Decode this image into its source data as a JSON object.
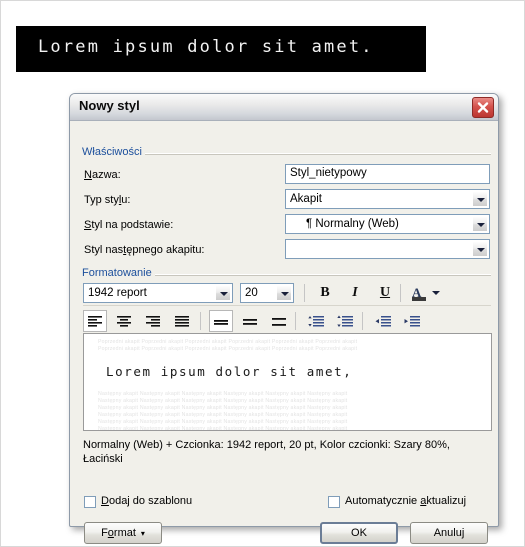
{
  "banner": {
    "text": "Lorem ipsum dolor sit amet."
  },
  "dialog": {
    "title": "Nowy styl",
    "close_icon": "close-icon",
    "properties": {
      "group_label": "Właściwości",
      "name_label": "Nazwa:",
      "name_value": "Styl_nietypowy",
      "style_type_label": "Typ stylu:",
      "style_type_value": "Akapit",
      "based_on_label": "Styl na podstawie:",
      "based_on_value": "¶ Normalny (Web)",
      "next_style_label": "Styl następnego akapitu:",
      "next_style_value": ""
    },
    "formatting": {
      "group_label": "Formatowanie",
      "font_family": "1942 report",
      "font_size": "20",
      "bold": "B",
      "italic": "I",
      "underline": "U",
      "font_color": "A",
      "align_left": "align-left-icon",
      "align_center": "align-center-icon",
      "align_right": "align-right-icon",
      "align_justify": "align-justify-icon",
      "line_single": "line-spacing-single-icon",
      "line_1_5": "line-spacing-1-5-icon",
      "line_double": "line-spacing-double-icon",
      "space_before": "space-before-icon",
      "space_after": "space-after-icon",
      "indent_decrease": "decrease-indent-icon",
      "indent_increase": "increase-indent-icon"
    },
    "preview": {
      "placeholder_text": "Poprzedni akapit Poprzedni akapit Poprzedni akapit Poprzedni akapit Poprzedni akapit Poprzedni akapit",
      "sample_text": "Lorem ipsum dolor sit amet,",
      "following_text": "Następny akapit Następny akapit Następny akapit Następny akapit Następny akapit Następny akapit"
    },
    "description": "Normalny (Web) + Czcionka: 1942 report, 20 pt, Kolor czcionki: Szary 80%, Łaciński",
    "options": {
      "add_to_template": "Dodaj do szablonu",
      "auto_update": "Automatycznie aktualizuj"
    },
    "buttons": {
      "format": "Format",
      "format_arrow": "▾",
      "ok": "OK",
      "cancel": "Anuluj"
    }
  },
  "colors": {
    "accent_blue": "#1c4f9c",
    "close_red": "#d4524c",
    "dialog_bg": "#f1f0ea",
    "banner_bg": "#000000"
  }
}
